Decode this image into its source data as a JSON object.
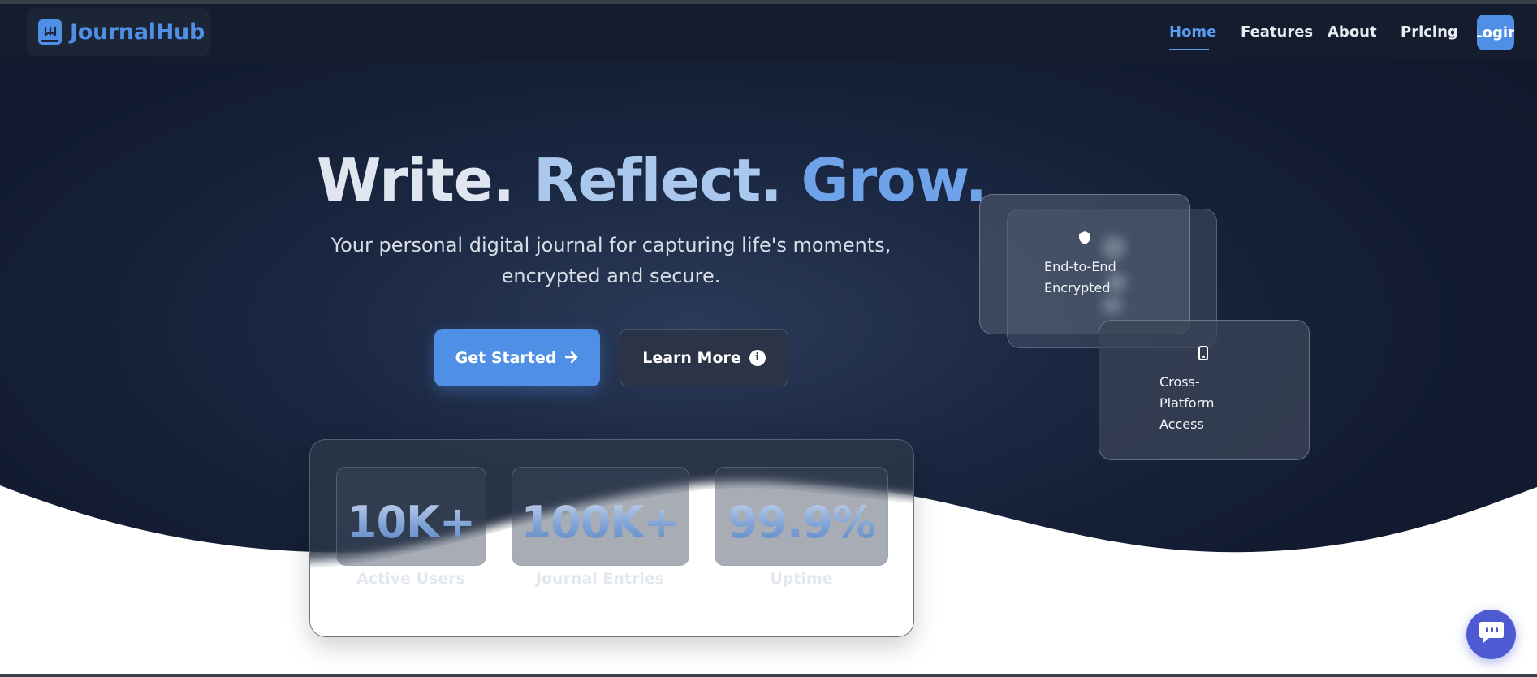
{
  "brand": {
    "name": "JournalHub",
    "logo_icon": "book-icon",
    "accent": "#4f8fe6"
  },
  "nav": {
    "links": [
      {
        "label": "Home",
        "active": true
      },
      {
        "label": "Features",
        "active": false
      },
      {
        "label": "About",
        "active": false
      },
      {
        "label": "Pricing",
        "active": false
      }
    ],
    "login_label": "Login"
  },
  "hero": {
    "title_words": [
      "Write.",
      "Reflect.",
      "Grow."
    ],
    "subtitle": "Your personal digital journal for capturing life's moments, encrypted and secure.",
    "primary_cta": {
      "label": "Get Started",
      "icon": "arrow-right-icon"
    },
    "secondary_cta": {
      "label": "Learn More",
      "icon": "info-icon"
    }
  },
  "feature_cards": [
    {
      "label": "End-to-End Encrypted",
      "icon": "shield-icon"
    },
    {
      "label": "Cross-Platform Access",
      "icon": "mobile-icon"
    }
  ],
  "stats": [
    {
      "value": "10K+",
      "label": "Active Users"
    },
    {
      "value": "100K+",
      "label": "Journal Entries"
    },
    {
      "value": "99.9%",
      "label": "Uptime"
    }
  ],
  "chat_widget": {
    "icon": "chat-bubble-icon",
    "color": "#4d5ad1"
  }
}
